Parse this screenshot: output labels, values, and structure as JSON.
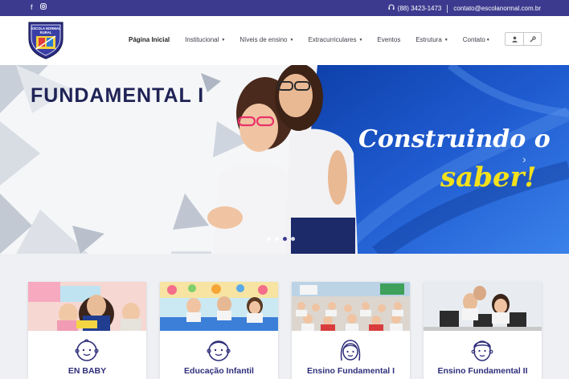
{
  "topbar": {
    "social_icons": [
      "facebook-icon",
      "instagram-icon"
    ],
    "phone_icon": "headset-icon",
    "phone": "(88) 3423-1473",
    "email": "contato@escolanormal.com.br"
  },
  "logo": {
    "text_line1": "ESCOLA NORMAL",
    "text_line2": "RURAL"
  },
  "nav": {
    "items": [
      {
        "label": "Página Inicial",
        "dropdown": false
      },
      {
        "label": "Institucional",
        "dropdown": true
      },
      {
        "label": "Níveis de ensino",
        "dropdown": true
      },
      {
        "label": "Extracurriculares",
        "dropdown": true
      },
      {
        "label": "Eventos",
        "dropdown": false
      },
      {
        "label": "Estrutura",
        "dropdown": true
      },
      {
        "label": "Contato",
        "dropdown": true
      }
    ],
    "caret": "▼",
    "user_icon": "user-icon",
    "tools_icon": "wrench-icon"
  },
  "hero": {
    "title": "FUNDAMENTAL I",
    "script_line1": "Construindo o",
    "script_line2": "saber!",
    "arrow": "›",
    "slide_count": 4,
    "active_slide": 2
  },
  "cards": [
    {
      "label": "EN BABY",
      "icon": "baby-face-icon"
    },
    {
      "label": "Educação Infantil",
      "icon": "child-face-icon"
    },
    {
      "label": "Ensino Fundamental I",
      "icon": "girl-face-icon"
    },
    {
      "label": "Ensino Fundamental II",
      "icon": "boy-face-icon"
    }
  ],
  "colors": {
    "brand": "#3c3a8e",
    "hero_blue": "#1f5bd0",
    "hero_yellow": "#f3e11c",
    "hero_title": "#1f2356"
  }
}
